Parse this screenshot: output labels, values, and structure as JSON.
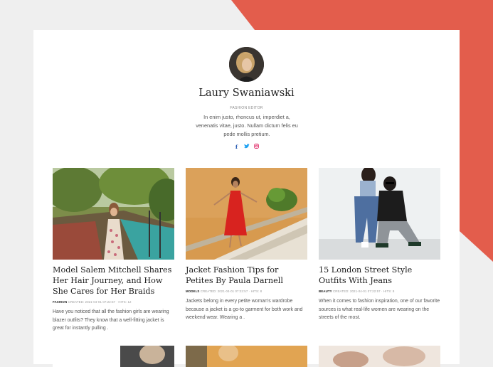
{
  "author": {
    "name": "Laury Swaniawski",
    "role": "FASHION EDITOR",
    "bio": "In enim justo, rhoncus ut, imperdiet a, venenatis vitae, justo. Nullam dictum felis eu pede mollis pretium.",
    "social_icons": [
      "facebook-icon",
      "twitter-icon",
      "instagram-icon"
    ]
  },
  "colors": {
    "accent": "#e35d4c",
    "background": "#efefef",
    "card": "#ffffff"
  },
  "articles": [
    {
      "title": "Model Salem Mitchell Shares Her Hair Journey, and How She Cares for Her Braids",
      "category": "FASHION",
      "meta": "CREATED: 2021-04-01 07:22:57 · HITS: 12",
      "excerpt": "Have you noticed that all the fashion girls are wearing blazer outfits? They know that a well-fitting jacket is great for instantly pulling ."
    },
    {
      "title": "Jacket Fashion Tips for Petites By Paula Darnell",
      "category": "MODELS",
      "meta": "CREATED: 2021-04-01 07:22:57 · HITS: 8",
      "excerpt": "Jackets belong in every petite woman's wardrobe because a jacket is a go-to garment for both work and weekend wear. Wearing a ."
    },
    {
      "title": "15 London Street Style Outfits With Jeans",
      "category": "BEAUTY",
      "meta": "CREATED: 2021-04-01 07:22:57 · HITS: 8",
      "excerpt": "When it comes to fashion inspiration, one of our favorite sources is what real-life women are wearing on the streets of the most."
    }
  ]
}
